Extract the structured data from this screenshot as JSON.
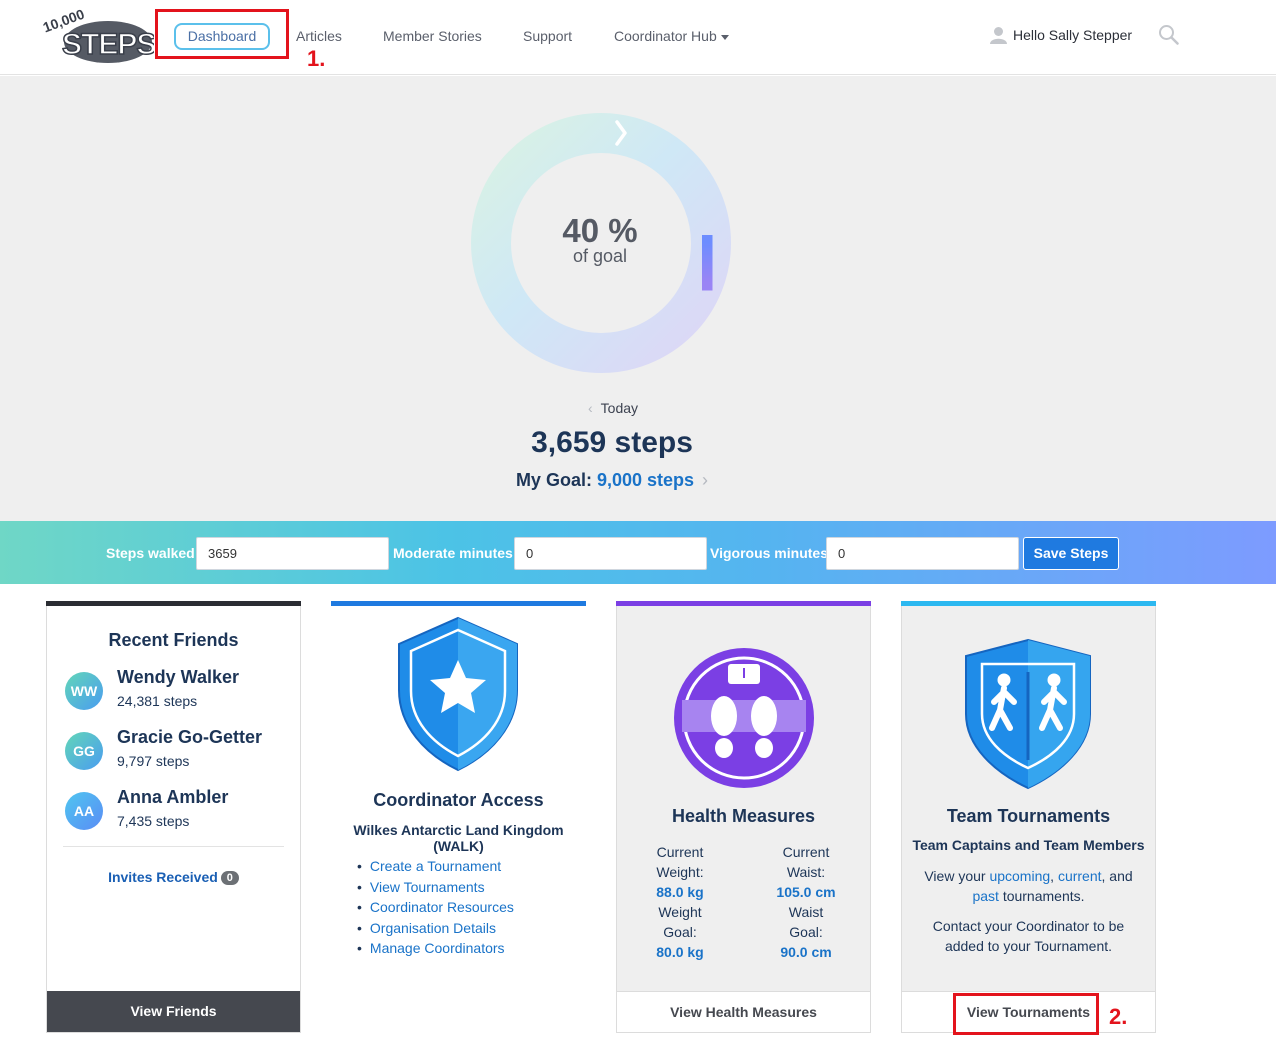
{
  "header": {
    "nav": {
      "dashboard": "Dashboard",
      "articles": "Articles",
      "member_stories": "Member Stories",
      "support": "Support",
      "coordinator_hub": "Coordinator Hub"
    },
    "user_greeting": "Hello Sally Stepper"
  },
  "annotations": {
    "one": "1.",
    "two": "2."
  },
  "hero": {
    "percent": "40 %",
    "percent_label": "of goal",
    "progress_fraction": 0.4,
    "day_label": "Today",
    "steps_today": "3,659 steps",
    "goal_label": "My Goal:",
    "goal_value": "9,000 steps"
  },
  "steps_bar": {
    "steps_label": "Steps walked",
    "steps_value": "3659",
    "moderate_label": "Moderate minutes",
    "moderate_value": "0",
    "vigorous_label": "Vigorous minutes",
    "vigorous_value": "0",
    "save_label": "Save Steps"
  },
  "friends_card": {
    "title": "Recent Friends",
    "friends": [
      {
        "initials": "WW",
        "name": "Wendy Walker",
        "steps": "24,381 steps"
      },
      {
        "initials": "GG",
        "name": "Gracie Go-Getter",
        "steps": "9,797 steps"
      },
      {
        "initials": "AA",
        "name": "Anna Ambler",
        "steps": "7,435 steps"
      }
    ],
    "invites_label": "Invites Received",
    "invites_count": "0",
    "footer": "View Friends"
  },
  "coordinator_card": {
    "title": "Coordinator Access",
    "org": "Wilkes Antarctic Land Kingdom (WALK)",
    "links": [
      "Create a Tournament",
      "View Tournaments",
      "Coordinator Resources",
      "Organisation Details",
      "Manage Coordinators"
    ]
  },
  "health_card": {
    "title": "Health Measures",
    "weight": {
      "l1": "Current",
      "l2": "Weight:",
      "current": "88.0 kg",
      "g1": "Weight",
      "g2": "Goal:",
      "goal": "80.0 kg"
    },
    "waist": {
      "l1": "Current",
      "l2": "Waist:",
      "current": "105.0 cm",
      "g1": "Waist",
      "g2": "Goal:",
      "goal": "90.0 cm"
    },
    "footer": "View Health Measures"
  },
  "tournaments_card": {
    "title": "Team Tournaments",
    "subtitle": "Team Captains and Team Members",
    "view_your": "View your",
    "upcoming": "upcoming",
    "current": "current",
    "and": ", and",
    "past": "past",
    "tournaments_suffix": "tournaments.",
    "contact_line1": "Contact your Coordinator to be",
    "contact_line2": "added to your Tournament.",
    "footer": "View Tournaments"
  },
  "colors": {
    "navy": "#1d3557",
    "link": "#1a73c8",
    "friends_accent": "#2b2d33",
    "coordinator_accent": "#1f7ae0",
    "health_accent": "#7b3fe4",
    "tournaments_accent": "#2cb8f0",
    "annotation": "#e3131c"
  }
}
